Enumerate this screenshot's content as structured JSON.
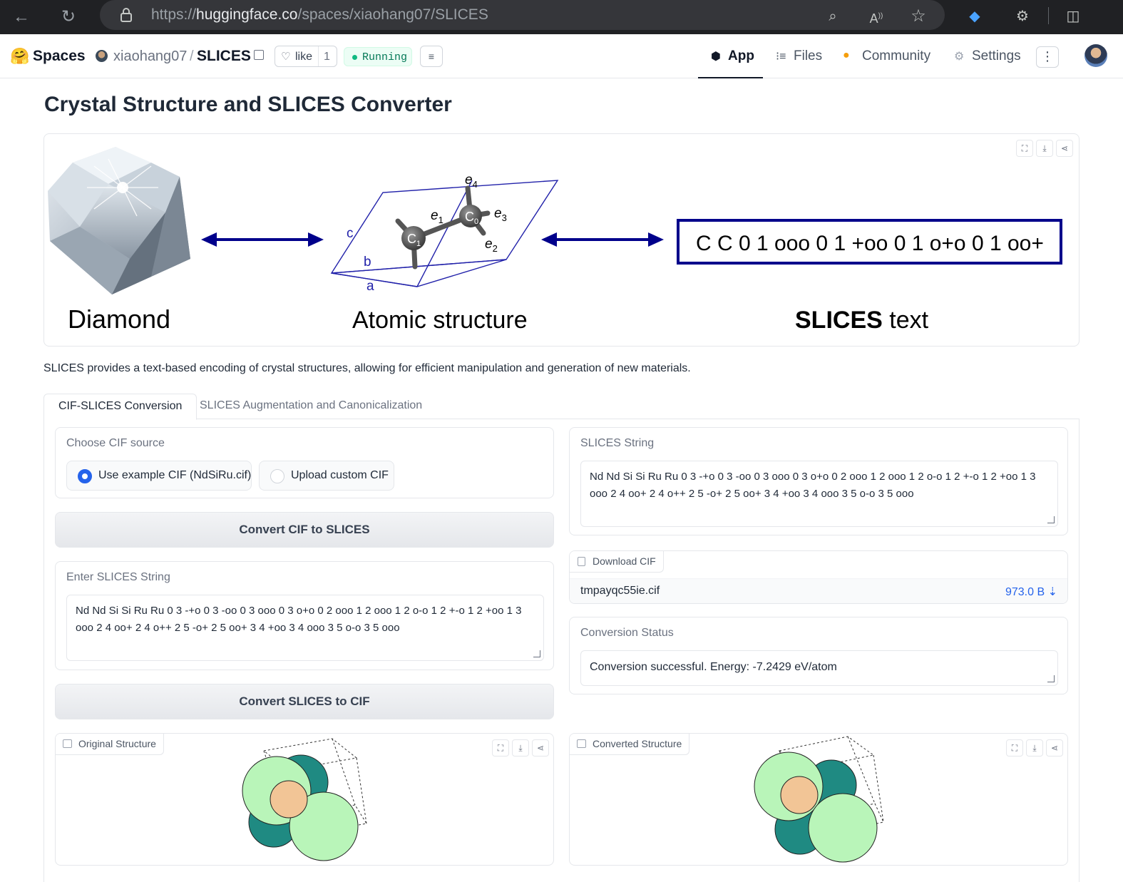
{
  "browser": {
    "url_scheme": "https://",
    "url_host": "huggingface.co",
    "url_path": "/spaces/xiaohang07/SLICES"
  },
  "header": {
    "logo": "🤗",
    "spaces_label": "Spaces",
    "owner": "xiaohang07",
    "separator": "/",
    "space_name": "SLICES",
    "like_label": "like",
    "like_count": "1",
    "status_label": "Running",
    "tabs": [
      {
        "label": "App",
        "icon": "cube-icon"
      },
      {
        "label": "Files",
        "icon": "files-icon"
      },
      {
        "label": "Community",
        "icon": "community-icon"
      },
      {
        "label": "Settings",
        "icon": "gear-icon"
      }
    ]
  },
  "main": {
    "title": "Crystal Structure and SLICES Converter",
    "hero": {
      "label_diamond": "Diamond",
      "label_atomic": "Atomic structure",
      "label_slices_bold": "SLICES",
      "label_slices_rest": " text",
      "slices_example": "C C 0 1 ooo 0 1 +oo 0 1 o+o 0 1 oo+",
      "lattice_labels": [
        "a",
        "b",
        "c"
      ],
      "atom_labels": [
        "C",
        "1",
        "C",
        "0"
      ],
      "edge_labels": [
        {
          "e": "e",
          "n": "1"
        },
        {
          "e": "e",
          "n": "2"
        },
        {
          "e": "e",
          "n": "3"
        },
        {
          "e": "e",
          "n": "4"
        }
      ]
    },
    "description": "SLICES provides a text-based encoding of crystal structures, allowing for efficient manipulation and generation of new materials.",
    "tabs": [
      {
        "label": "CIF-SLICES Conversion",
        "active": true
      },
      {
        "label": "SLICES Augmentation and Canonicalization",
        "active": false
      }
    ],
    "cif_source": {
      "label": "Choose CIF source",
      "options": [
        "Use example CIF (NdSiRu.cif)",
        "Upload custom CIF"
      ],
      "selected": "Use example CIF (NdSiRu.cif)"
    },
    "convert_cif_button": "Convert CIF to SLICES",
    "enter_slices": {
      "label": "Enter SLICES String",
      "value": "Nd Nd Si Si Ru Ru 0 3 -+o 0 3 -oo 0 3 ooo 0 3 o+o 0 2 ooo 1 2 ooo 1 2 o-o 1 2 +-o 1 2 +oo 1 3 ooo 2 4 oo+ 2 4 o++ 2 5 -o+ 2 5 oo+ 3 4 +oo 3 4 ooo 3 5 o-o 3 5 ooo"
    },
    "convert_slices_button": "Convert SLICES to CIF",
    "slices_output": {
      "label": "SLICES String",
      "value": "Nd Nd Si Si Ru Ru 0 3 -+o 0 3 -oo 0 3 ooo 0 3 o+o 0 2 ooo 1 2 ooo 1 2 o-o 1 2 +-o 1 2 +oo 1 3 ooo 2 4 oo+ 2 4 o++ 2 5 -o+ 2 5 oo+ 3 4 +oo 3 4 ooo 3 5 o-o 3 5 ooo"
    },
    "download_cif": {
      "label": "Download CIF",
      "file_name": "tmpayqc55ie.cif",
      "file_size": "973.0 B ⇣"
    },
    "conversion_status": {
      "label": "Conversion Status",
      "value": "Conversion successful. Energy: -7.2429 eV/atom"
    },
    "original_structure_label": "Original Structure",
    "converted_structure_label": "Converted Structure"
  },
  "colors": {
    "accent_blue": "#2563eb",
    "hero_blue": "#00008b",
    "atom_light_green": "#b9f5b9",
    "atom_teal": "#1f8a82",
    "atom_peach": "#f2c596"
  }
}
